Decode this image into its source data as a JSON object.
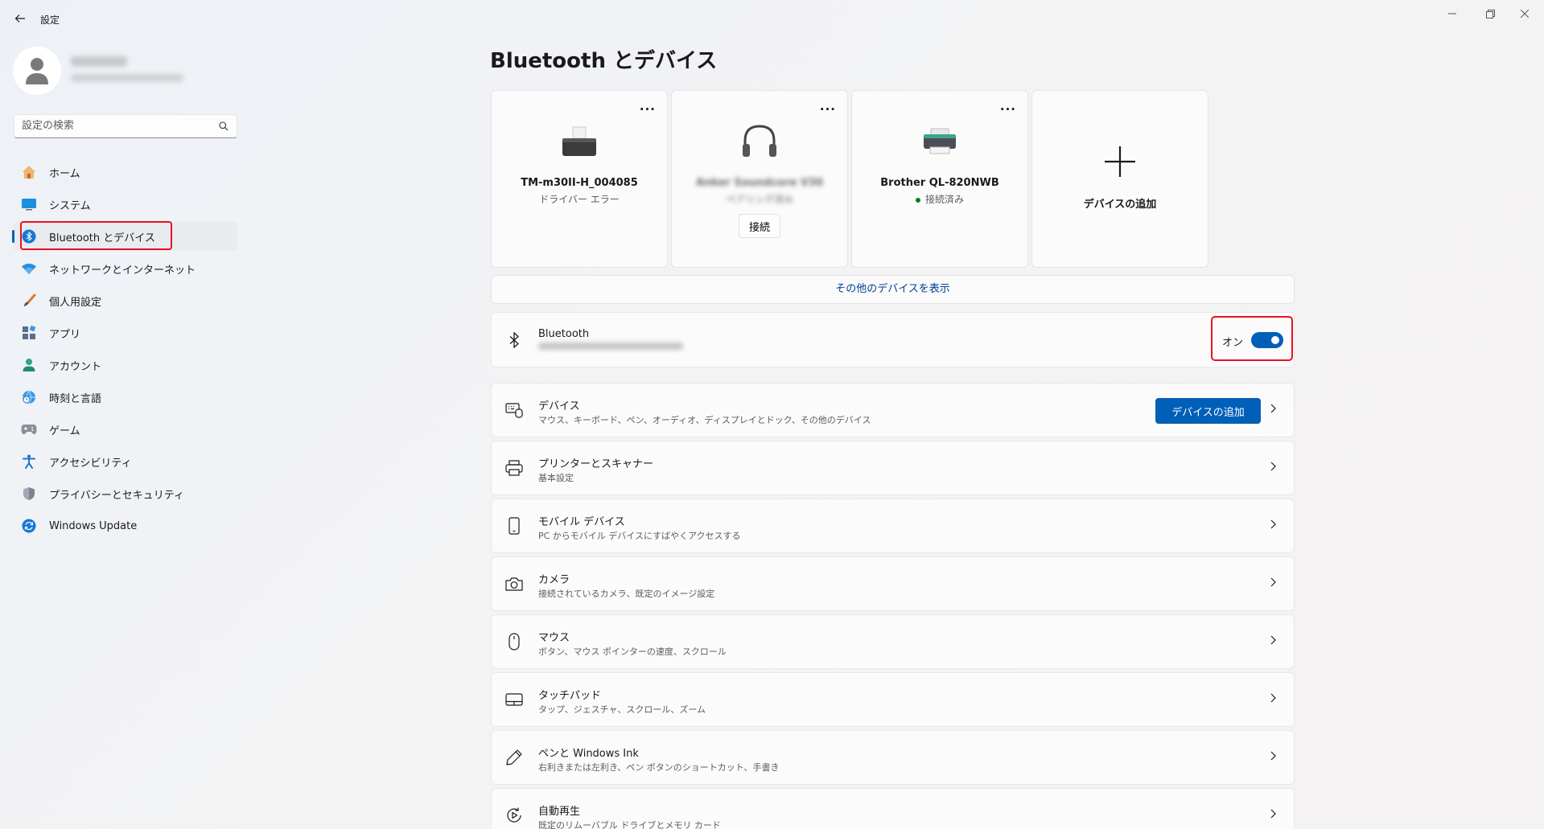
{
  "window": {
    "title": "設定"
  },
  "search": {
    "placeholder": "設定の検索"
  },
  "sidebar": {
    "items": [
      {
        "label": "ホーム"
      },
      {
        "label": "システム"
      },
      {
        "label": "Bluetooth とデバイス"
      },
      {
        "label": "ネットワークとインターネット"
      },
      {
        "label": "個人用設定"
      },
      {
        "label": "アプリ"
      },
      {
        "label": "アカウント"
      },
      {
        "label": "時刻と言語"
      },
      {
        "label": "ゲーム"
      },
      {
        "label": "アクセシビリティ"
      },
      {
        "label": "プライバシーとセキュリティ"
      },
      {
        "label": "Windows Update"
      }
    ]
  },
  "main": {
    "title": "Bluetooth とデバイス",
    "cards": [
      {
        "name": "TM-m30II-H_004085",
        "status": "ドライバー エラー",
        "more": "..."
      },
      {
        "name": "Anker Soundcore V30",
        "status": "ペアリング済み",
        "action": "接続",
        "more": "..."
      },
      {
        "name": "Brother QL-820NWB",
        "status": "接続済み",
        "more": "..."
      },
      {
        "name": "デバイスの追加"
      }
    ],
    "more_devices": "その他のデバイスを表示",
    "bluetooth": {
      "title": "Bluetooth",
      "toggle_label": "オン"
    },
    "rows": [
      {
        "title": "デバイス",
        "subtitle": "マウス、キーボード、ペン、オーディオ、ディスプレイとドック、その他のデバイス",
        "button": "デバイスの追加"
      },
      {
        "title": "プリンターとスキャナー",
        "subtitle": "基本設定"
      },
      {
        "title": "モバイル デバイス",
        "subtitle": "PC からモバイル デバイスにすばやくアクセスする"
      },
      {
        "title": "カメラ",
        "subtitle": "接続されているカメラ、既定のイメージ設定"
      },
      {
        "title": "マウス",
        "subtitle": "ボタン、マウス ポインターの速度、スクロール"
      },
      {
        "title": "タッチパッド",
        "subtitle": "タップ、ジェスチャ、スクロール、ズーム"
      },
      {
        "title": "ペンと Windows Ink",
        "subtitle": "右利きまたは左利き、ペン ボタンのショートカット、手書き"
      },
      {
        "title": "自動再生",
        "subtitle": "既定のリムーバブル ドライブとメモリ カード"
      }
    ]
  }
}
